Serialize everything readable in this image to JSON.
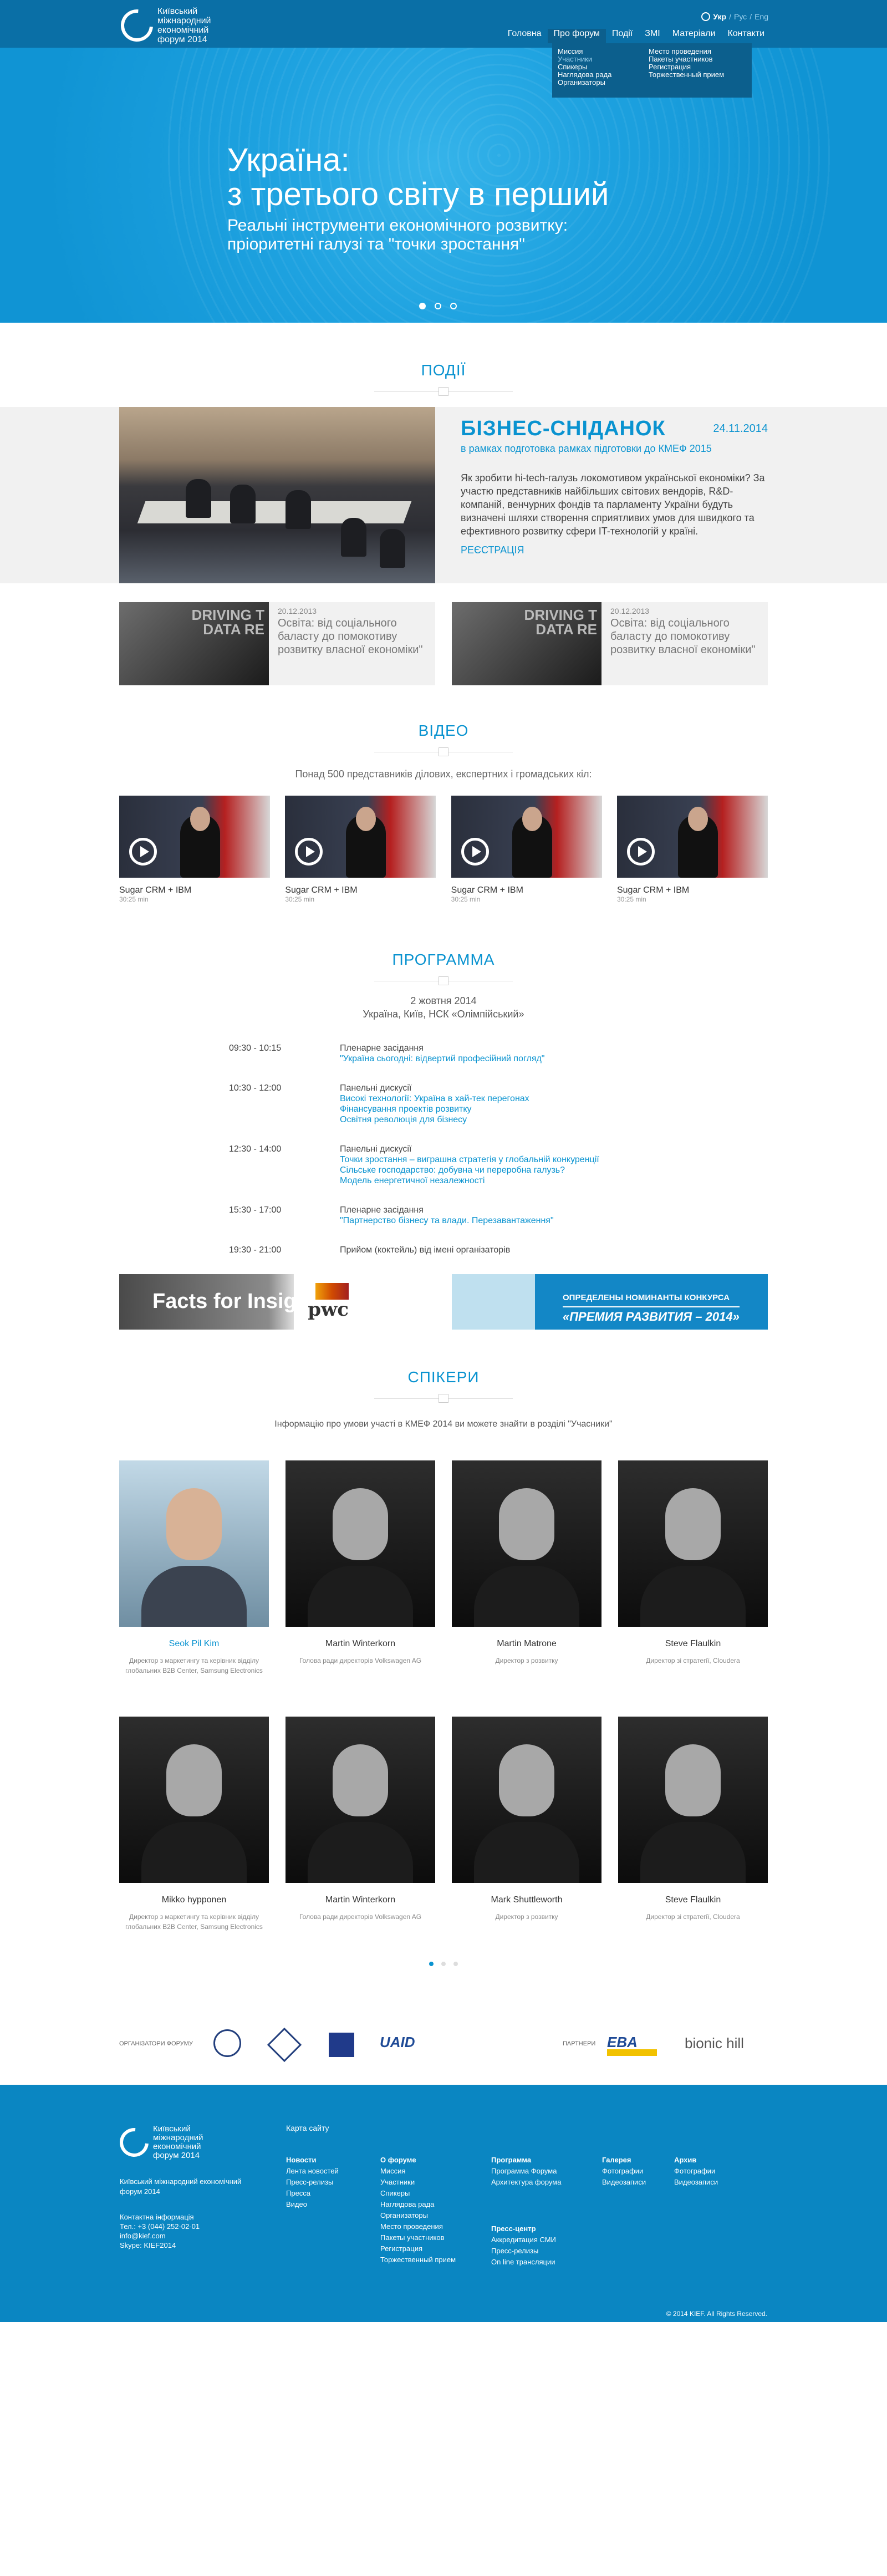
{
  "header": {
    "logo_lines": [
      "Київський",
      "міжнародний",
      "економічний",
      "форум 2014"
    ],
    "langs": [
      "Укр",
      "Рус",
      "Eng"
    ],
    "nav": [
      "Головна",
      "Про форум",
      "Події",
      "ЗМІ",
      "Матеріали",
      "Контакти"
    ],
    "dropdown_col1": [
      "Миссия",
      "Участники",
      "Спикеры",
      "Наглядова рада",
      "Организаторы"
    ],
    "dropdown_col2": [
      "Место проведения",
      "Пакеты участников",
      "Регистрация",
      "Торжественный прием"
    ]
  },
  "hero": {
    "title_line1": "Україна:",
    "title_line2": "з третього світу в перший",
    "sub_line1": "Реальні інструменти економічного розвитку:",
    "sub_line2": "пріоритетні галузі та \"точки зростання\""
  },
  "events": {
    "title": "ПОДІЇ",
    "featured": {
      "title": "БІЗНЕС-СНІДАНОК",
      "date": "24.11.2014",
      "lead": "в рамках подготовка рамках підготовки до КМЕФ 2015",
      "text": "Як зробити hi-tech-галузь локомотивом української економіки? За участю представників найбільших світових вендорів, R&D-компаній, венчурних фондів та парламенту України будуть визначені шляхи створення сприятливих умов для швидкого та ефективного розвитку сфери IT-технологій у країні.",
      "link": "РЕЄСТРАЦІЯ"
    },
    "small": [
      {
        "date": "20.12.2013",
        "title": "Освіта: від соціального баласту до помокотиву розвитку власної економіки\"",
        "img_text": "DRIVING T\nDATA RE"
      },
      {
        "date": "20.12.2013",
        "title": "Освіта: від соціального баласту до помокотиву розвитку власної економіки\"",
        "img_text": "DRIVING T\nDATA RE"
      }
    ]
  },
  "video": {
    "title": "ВІДЕО",
    "lead": "Понад 500 представників ділових, експертних і громадських кіл:",
    "items": [
      {
        "title": "Sugar CRM + IBM",
        "duration": "30:25 min"
      },
      {
        "title": "Sugar CRM + IBM",
        "duration": "30:25 min"
      },
      {
        "title": "Sugar CRM + IBM",
        "duration": "30:25 min"
      },
      {
        "title": "Sugar CRM + IBM",
        "duration": "30:25 min"
      }
    ]
  },
  "program": {
    "title": "ПРОГРАММА",
    "date_line1": "2 жовтня 2014",
    "date_line2": "Україна, Київ, НСК «Олімпійський»",
    "rows": [
      {
        "time": "09:30 - 10:15",
        "title": "Пленарне засідання",
        "links": [
          "\"Україна сьогодні: відвертий професійний погляд\""
        ]
      },
      {
        "time": "10:30 - 12:00",
        "title": "Панельні дискусії",
        "links": [
          "Високі технології: Україна в хай-тек перегонах",
          "Фінансування проектів розвитку",
          "Освітня революція для бізнесу"
        ]
      },
      {
        "time": "12:30 - 14:00",
        "title": "Панельні дискусії",
        "links": [
          "Точки зростання – виграшна стратегія у глобальній конкуренції",
          "Сільське господарство: добувна чи переробна галузь?",
          "Модель енергетичної незалежності"
        ]
      },
      {
        "time": "15:30 - 17:00",
        "title": "Пленарне засідання",
        "links": [
          "\"Партнерство бізнесу та влади. Перезавантаження\""
        ]
      },
      {
        "time": "19:30 - 21:00",
        "title": "Прийом (коктейль) від імені організаторів",
        "links": []
      }
    ],
    "banner1": {
      "text": "Facts for Insight",
      "brand": "pwc"
    },
    "banner2": {
      "line1": "ОПРЕДЕЛЕНЫ НОМИНАНТЫ КОНКУРСА",
      "line2": "«ПРЕМИЯ РАЗВИТИЯ – 2014»"
    }
  },
  "speakers": {
    "title": "СПІКЕРИ",
    "lead": "Інформацію про умови участі в КМЕФ 2014 ви можете знайти в розділі \"Учасники\"",
    "items": [
      {
        "name": "Seok Pil Kim",
        "role": "Директор з маркетингу та керівник відділу глобальних B2B Center, Samsung Electronics"
      },
      {
        "name": "Martin Winterkorn",
        "role": "Голова ради директорів Volkswagen AG"
      },
      {
        "name": "Martin Matrone",
        "role": "Директор з розвитку"
      },
      {
        "name": "Steve Flaulkin",
        "role": "Директор зі стратегії, Cloudera"
      },
      {
        "name": "Mikko hypponen",
        "role": "Директор з маркетингу та керівник відділу глобальних B2B Center, Samsung Electronics"
      },
      {
        "name": "Martin Winterkorn",
        "role": "Голова ради директорів Volkswagen AG"
      },
      {
        "name": "Mark Shuttleworth",
        "role": "Директор з розвитку"
      },
      {
        "name": "Steve Flaulkin",
        "role": "Директор зі стратегії, Cloudera"
      }
    ]
  },
  "partners": {
    "organizers_label": "ОРГАНІЗАТОРИ ФОРУМУ",
    "partners_label": "ПАРТНЕРИ",
    "uaid": "UAID",
    "eba": "EBA",
    "bionic": "bionic hill"
  },
  "footer": {
    "logo_lines": [
      "Київський",
      "міжнародний",
      "економічний",
      "форум 2014"
    ],
    "about": "Київський міжнародний економічний форум 2014",
    "contacts": [
      "Контактна  інформація",
      "Тел.: +3 (044) 252-02-01",
      "info@kief.com",
      "Skype: KIEF2014"
    ],
    "sitemap": "Карта сайту",
    "col1": {
      "head": "Новости",
      "items": [
        "Лента новостей",
        "Пресс-релизы",
        "Пресса",
        "Видео"
      ]
    },
    "col2": {
      "head": "О форуме",
      "items": [
        "Миссия",
        "Участники",
        "Спикеры",
        "Наглядова рада",
        "Организаторы",
        "Место проведения",
        "Пакеты участников",
        "Регистрация",
        "Торжественный прием"
      ]
    },
    "col3": {
      "head": "Программа",
      "items": [
        "Программа Форума",
        "Архитектура форума"
      ]
    },
    "col3b": {
      "head": "Пресс-центр",
      "items": [
        "Аккредитация СМИ",
        "Пресс-релизы",
        "On line трансляции"
      ]
    },
    "col4": {
      "head": "Галерея",
      "items": [
        "Фотографии",
        "Видеозаписи"
      ]
    },
    "col5": {
      "head": "Архив",
      "items": [
        "Фотографии",
        "Видеозаписи"
      ]
    },
    "copyright": "© 2014 KIEF. All Rights Reserved."
  }
}
